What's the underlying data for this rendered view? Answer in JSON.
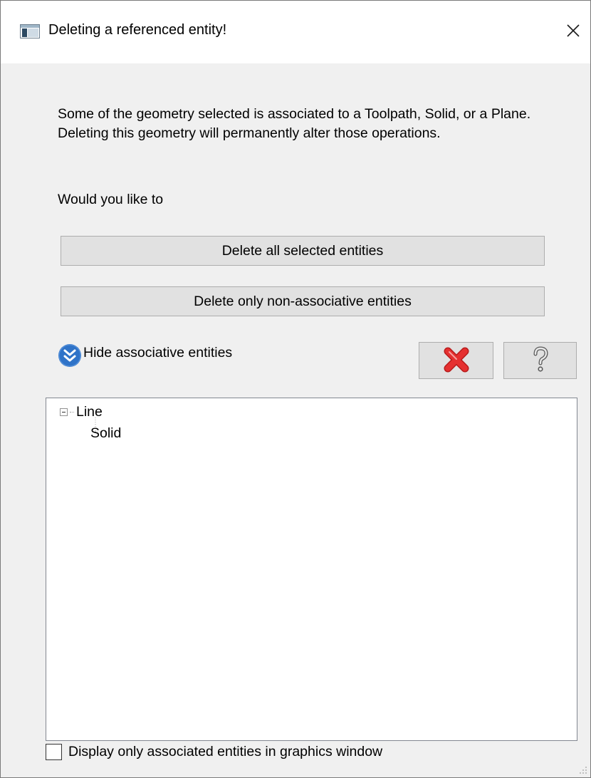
{
  "window": {
    "title": "Deleting a referenced entity!",
    "icons": {
      "app": "application-icon",
      "close": "close-icon"
    }
  },
  "body": {
    "message": "Some of the geometry selected is associated to a Toolpath, Solid, or a Plane.  Deleting this geometry will permanently alter those operations.",
    "question": "Would you like to",
    "delete_all_label": "Delete all selected entities",
    "delete_non_assoc_label": "Delete only non-associative entities",
    "expander_label": "Hide associative entities",
    "icons": {
      "expander": "chevron-double-down-icon",
      "cancel": "red-x-icon",
      "help": "question-mark-icon"
    }
  },
  "tree": {
    "items": [
      {
        "label": "Line",
        "expanded": true
      },
      {
        "label": "Solid"
      }
    ]
  },
  "footer": {
    "checkbox_label": "Display only associated entities in graphics window",
    "checkbox_checked": false
  },
  "colors": {
    "cancel_red": "#e53030",
    "expander_blue": "#2f73c8"
  }
}
